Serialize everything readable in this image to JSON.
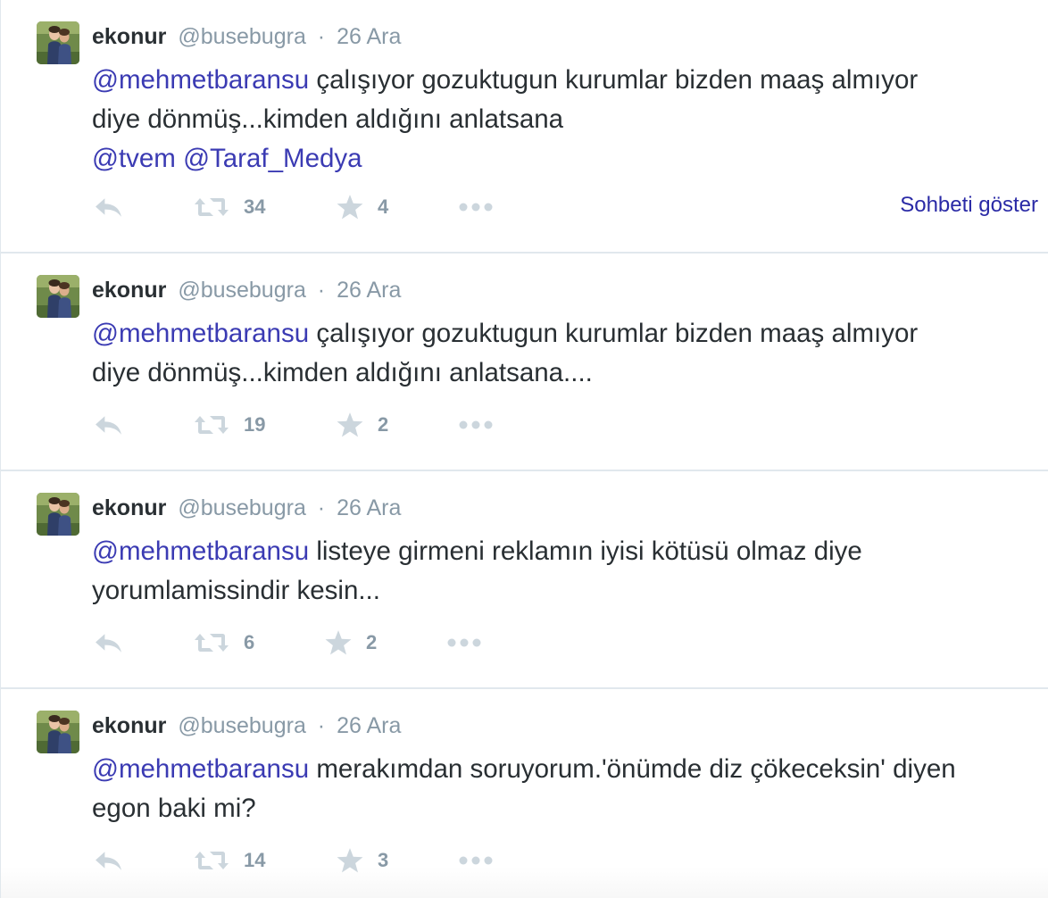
{
  "tweets": [
    {
      "fullname": "ekonur",
      "username": "@busebugra",
      "dot": "·",
      "time": "26 Ara",
      "mention": "@mehmetbaransu",
      "text_line1": " çalışıyor gozuktugun kurumlar bizden maaş almıyor",
      "text_line2": "diye dönmüş...kimden aldığını anlatsana",
      "mention2": "@tvem",
      "mention3": "@Taraf_Medya",
      "retweets": "34",
      "favorites": "4",
      "show_conversation": "Sohbeti göster"
    },
    {
      "fullname": "ekonur",
      "username": "@busebugra",
      "dot": "·",
      "time": "26 Ara",
      "mention": "@mehmetbaransu",
      "text_line1": " çalışıyor gozuktugun kurumlar bizden maaş almıyor",
      "text_line2": "diye dönmüş...kimden aldığını anlatsana....",
      "retweets": "19",
      "favorites": "2"
    },
    {
      "fullname": "ekonur",
      "username": "@busebugra",
      "dot": "·",
      "time": "26 Ara",
      "mention": "@mehmetbaransu",
      "text_line1": " listeye girmeni reklamın iyisi kötüsü olmaz diye",
      "text_line2": "yorumlamissindir kesin...",
      "retweets": "6",
      "favorites": "2"
    },
    {
      "fullname": "ekonur",
      "username": "@busebugra",
      "dot": "·",
      "time": "26 Ara",
      "mention": "@mehmetbaransu",
      "text_line1": " merakımdan soruyorum.'önümde diz çökeceksin' diyen",
      "text_line2": "egon baki mi?",
      "retweets": "14",
      "favorites": "3"
    }
  ],
  "icons": {
    "reply": "reply-icon",
    "retweet": "retweet-icon",
    "favorite": "star-icon",
    "more": "more-dots-icon"
  },
  "colors": {
    "mention": "#3b3bb3",
    "icon": "#ccd6dd",
    "muted": "#8899a6",
    "text": "#292f33",
    "divider": "#e1e8ed"
  }
}
